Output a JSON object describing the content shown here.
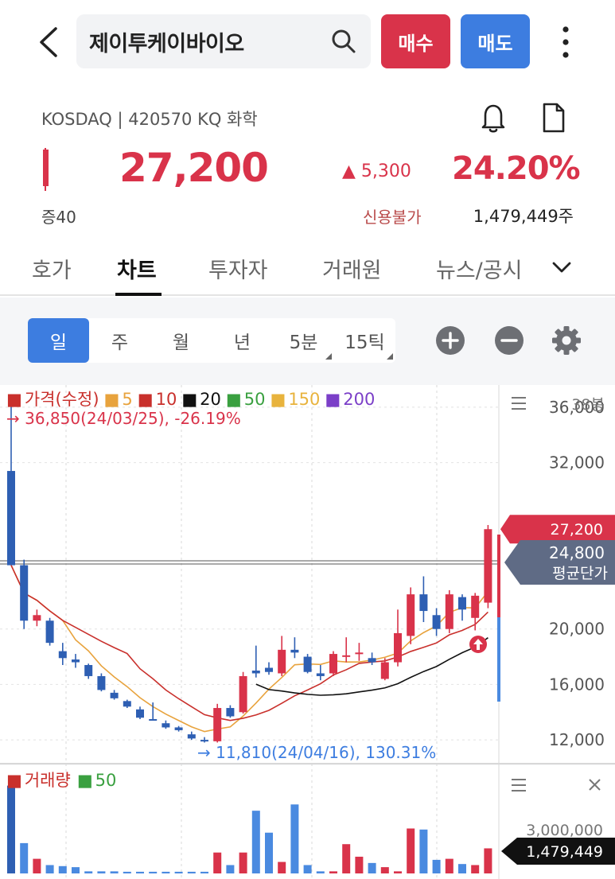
{
  "header": {
    "search_text": "제이투케이바이오",
    "buy_label": "매수",
    "sell_label": "매도"
  },
  "stock": {
    "market_line": "KOSDAQ | 420570 KQ 화학",
    "price": "27,200",
    "change_abs": "▲ 5,300",
    "change_pct": "24.20%",
    "margin_rate": "증40",
    "credit": "신용불가",
    "volume": "1,479,449주"
  },
  "tabs": [
    "호가",
    "차트",
    "투자자",
    "거래원",
    "뉴스/공시"
  ],
  "periods": [
    "일",
    "주",
    "월",
    "년",
    "5분",
    "15틱"
  ],
  "colors": {
    "up": "#d9334a",
    "down": "#2e5fb3",
    "accent": "#3d7de0"
  },
  "chart_data": {
    "type": "candlestick",
    "legend": [
      {
        "name": "가격(수정)",
        "color": "#c9302c"
      },
      {
        "name": "5",
        "color": "#e8a33d"
      },
      {
        "name": "10",
        "color": "#c9302c"
      },
      {
        "name": "20",
        "color": "#111111"
      },
      {
        "name": "50",
        "color": "#3aa040"
      },
      {
        "name": "150",
        "color": "#e8b33d"
      },
      {
        "name": "200",
        "color": "#7b3fc8"
      }
    ],
    "high_annotation": "→ 36,850(24/03/25), -26.19%",
    "low_annotation": "→ 11,810(24/04/16), 130.31%",
    "candle_count_label": "38봉",
    "y_ticks": [
      36000,
      32000,
      20000,
      16000,
      12000
    ],
    "y_tick_labels": [
      "36,000",
      "32,000",
      "20,000",
      "16,000",
      "12,000"
    ],
    "ylim": [
      10400,
      37600
    ],
    "current_price_label": "27,200",
    "current_price": 27200,
    "avg_price_label": "24,800",
    "avg_price_caption": "평균단가",
    "avg_price": 24800,
    "candles": [
      {
        "o": 31400,
        "h": 36850,
        "l": 24600,
        "c": 24600
      },
      {
        "o": 24600,
        "h": 25000,
        "l": 20000,
        "c": 20600
      },
      {
        "o": 20600,
        "h": 21400,
        "l": 20200,
        "c": 21000
      },
      {
        "o": 20600,
        "h": 20800,
        "l": 18800,
        "c": 19000
      },
      {
        "o": 18400,
        "h": 19000,
        "l": 17400,
        "c": 17900
      },
      {
        "o": 17800,
        "h": 18200,
        "l": 17200,
        "c": 17600
      },
      {
        "o": 17400,
        "h": 17500,
        "l": 16400,
        "c": 16600
      },
      {
        "o": 16600,
        "h": 16800,
        "l": 15500,
        "c": 15600
      },
      {
        "o": 15400,
        "h": 15600,
        "l": 14900,
        "c": 15000
      },
      {
        "o": 14800,
        "h": 14900,
        "l": 14300,
        "c": 14400
      },
      {
        "o": 14200,
        "h": 14400,
        "l": 13500,
        "c": 13600
      },
      {
        "o": 13500,
        "h": 14700,
        "l": 13400,
        "c": 13400
      },
      {
        "o": 13200,
        "h": 13400,
        "l": 12800,
        "c": 12900
      },
      {
        "o": 12900,
        "h": 13000,
        "l": 12600,
        "c": 12700
      },
      {
        "o": 12400,
        "h": 12600,
        "l": 12000,
        "c": 12100
      },
      {
        "o": 12000,
        "h": 12200,
        "l": 11810,
        "c": 11900
      },
      {
        "o": 11900,
        "h": 14600,
        "l": 11810,
        "c": 14300
      },
      {
        "o": 14300,
        "h": 14500,
        "l": 13600,
        "c": 13700
      },
      {
        "o": 14000,
        "h": 16900,
        "l": 13900,
        "c": 16600
      },
      {
        "o": 17000,
        "h": 18800,
        "l": 16500,
        "c": 16800
      },
      {
        "o": 17200,
        "h": 17600,
        "l": 16700,
        "c": 16900
      },
      {
        "o": 16800,
        "h": 19500,
        "l": 16600,
        "c": 18500
      },
      {
        "o": 18500,
        "h": 19400,
        "l": 17900,
        "c": 18300
      },
      {
        "o": 18000,
        "h": 18200,
        "l": 16800,
        "c": 16900
      },
      {
        "o": 16800,
        "h": 17400,
        "l": 16300,
        "c": 16600
      },
      {
        "o": 16800,
        "h": 18400,
        "l": 16600,
        "c": 18200
      },
      {
        "o": 18000,
        "h": 19400,
        "l": 17600,
        "c": 18100
      },
      {
        "o": 18200,
        "h": 19000,
        "l": 17700,
        "c": 18300
      },
      {
        "o": 17900,
        "h": 18300,
        "l": 17400,
        "c": 17600
      },
      {
        "o": 16400,
        "h": 17900,
        "l": 16300,
        "c": 17600
      },
      {
        "o": 17600,
        "h": 21400,
        "l": 17300,
        "c": 19700
      },
      {
        "o": 19500,
        "h": 23000,
        "l": 18900,
        "c": 22500
      },
      {
        "o": 22500,
        "h": 23800,
        "l": 20500,
        "c": 21300
      },
      {
        "o": 21000,
        "h": 21500,
        "l": 19500,
        "c": 20000
      },
      {
        "o": 20000,
        "h": 22800,
        "l": 19700,
        "c": 22500
      },
      {
        "o": 22300,
        "h": 22500,
        "l": 20600,
        "c": 21400
      },
      {
        "o": 20800,
        "h": 22600,
        "l": 19900,
        "c": 22400
      },
      {
        "o": 21900,
        "h": 27500,
        "l": 21500,
        "c": 27200
      }
    ],
    "volume_legend": [
      {
        "name": "거래량",
        "color": "#c9302c"
      },
      {
        "name": "50",
        "color": "#3aa040"
      }
    ],
    "volume_tick_label": "3,000,000",
    "volume_tick": 3000000,
    "volume_current_label": "1,479,449",
    "volume_current": 1479449,
    "volume_max": 4300000,
    "volumes": [
      4200000,
      1450000,
      700000,
      400000,
      350000,
      300000,
      100000,
      100000,
      100000,
      80000,
      80000,
      80000,
      80000,
      80000,
      80000,
      80000,
      1000000,
      400000,
      1000000,
      3000000,
      1950000,
      550000,
      3300000,
      400000,
      100000,
      100000,
      1400000,
      800000,
      500000,
      300000,
      100000,
      2150000,
      2100000,
      650000,
      700000,
      450000,
      400000,
      1200000
    ]
  }
}
